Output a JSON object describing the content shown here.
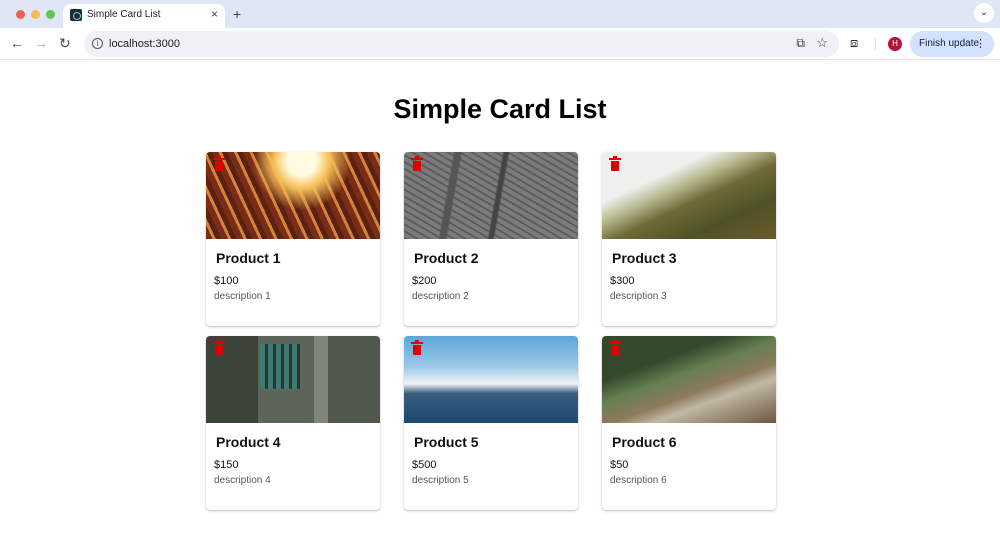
{
  "browser": {
    "tab_title": "Simple Card List",
    "tab_close": "×",
    "new_tab": "+",
    "tab_menu": "⌄",
    "back": "←",
    "forward": "→",
    "reload": "↻",
    "info": "i",
    "url": "localhost:3000",
    "cast_icon": "⧉",
    "star_icon": "☆",
    "extensions_icon": "⧈",
    "avatar_initial": "H",
    "finish_update_label": "Finish update",
    "menu_dots": "⋮"
  },
  "page": {
    "title": "Simple Card List"
  },
  "cards": [
    {
      "title": "Product 1",
      "price": "$100",
      "description": "description 1",
      "image": "building-sun"
    },
    {
      "title": "Product 2",
      "price": "$200",
      "description": "description 2",
      "image": "bridge"
    },
    {
      "title": "Product 3",
      "price": "$300",
      "description": "description 3",
      "image": "forest-hill"
    },
    {
      "title": "Product 4",
      "price": "$150",
      "description": "description 4",
      "image": "building-facade"
    },
    {
      "title": "Product 5",
      "price": "$500",
      "description": "description 5",
      "image": "ocean"
    },
    {
      "title": "Product 6",
      "price": "$50",
      "description": "description 6",
      "image": "forest-road"
    }
  ],
  "colors": {
    "delete_icon": "#e00000",
    "tabbar": "#dfe6f5",
    "finish_update_bg": "#d3e3fd",
    "avatar_bg": "#b0153c"
  }
}
